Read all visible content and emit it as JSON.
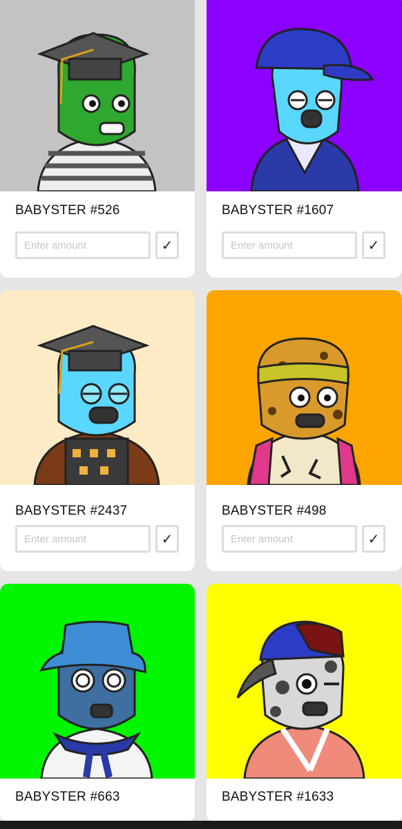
{
  "cards": [
    {
      "title": "BABYSTER #526",
      "bg": "#c3c3c3",
      "skin": "#2ea82e",
      "hat": "graduation-cap",
      "shirt": "striped",
      "amount_placeholder": "Enter amount",
      "confirm_label": "✓"
    },
    {
      "title": "BABYSTER #1607",
      "bg": "#8b00ff",
      "skin": "#5ad7ff",
      "hat": "baseball-cap",
      "shirt": "blue-robe",
      "amount_placeholder": "Enter amount",
      "confirm_label": "✓"
    },
    {
      "title": "BABYSTER #2437",
      "bg": "#fdebc5",
      "skin": "#5ad7ff",
      "hat": "graduation-cap",
      "shirt": "fur-armor",
      "amount_placeholder": "Enter amount",
      "confirm_label": "✓"
    },
    {
      "title": "BABYSTER #498",
      "bg": "#ffa500",
      "skin": "#d99a2b",
      "hat": "headband",
      "shirt": "cream-jersey",
      "amount_placeholder": "Enter amount",
      "confirm_label": "✓"
    },
    {
      "title": "BABYSTER #663",
      "bg": "#00f500",
      "skin": "#3f6fa0",
      "hat": "bucket-hat",
      "shirt": "sailor",
      "amount_placeholder": "",
      "confirm_label": ""
    },
    {
      "title": "BABYSTER #1633",
      "bg": "#ffff00",
      "skin": "#d8d8d8",
      "hat": "backwards-cap",
      "shirt": "pink-robe",
      "amount_placeholder": "",
      "confirm_label": ""
    }
  ]
}
